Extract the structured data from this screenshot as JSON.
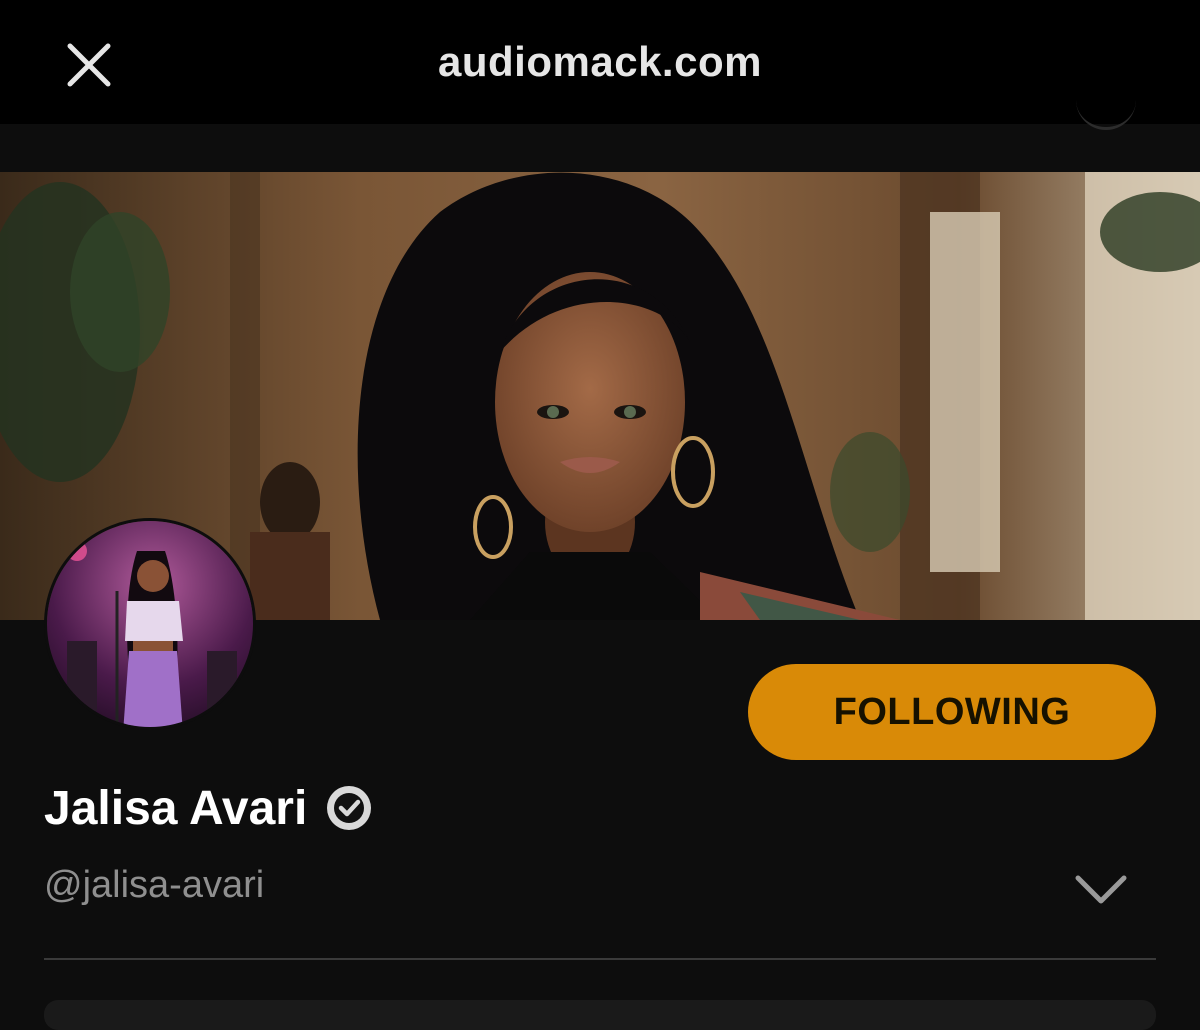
{
  "browser": {
    "domain": "audiomack.com",
    "close_icon": "close-icon"
  },
  "profile": {
    "banner_image": "banner-photo",
    "avatar_image": "avatar-photo",
    "follow_button_label": "FOLLOWING",
    "name": "Jalisa Avari",
    "verified_icon": "verified-check-icon",
    "handle": "@jalisa-avari",
    "expand_icon": "chevron-down-icon"
  },
  "colors": {
    "background": "#0d0d0d",
    "topbar": "#000000",
    "accent": "#d98a07",
    "handle_text": "#8f8f8f"
  }
}
